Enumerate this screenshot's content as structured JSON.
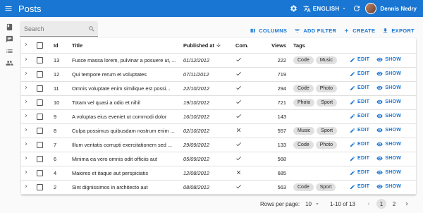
{
  "app": {
    "title": "Posts",
    "language": "ENGLISH",
    "user_name": "Dennis Nedry"
  },
  "search": {
    "placeholder": "Search"
  },
  "toolbar": {
    "columns": "COLUMNS",
    "add_filter": "ADD FILTER",
    "create": "CREATE",
    "export": "EXPORT"
  },
  "table": {
    "headers": {
      "id": "Id",
      "title": "Title",
      "published_at": "Published at",
      "com": "Com.",
      "views": "Views",
      "tags": "Tags"
    },
    "actions": {
      "edit": "EDIT",
      "show": "SHOW"
    },
    "rows": [
      {
        "id": "13",
        "title": "Fusce massa lorem, pulvinar a posuere ut, ...",
        "published_at": "01/12/2012",
        "com": true,
        "views": "222",
        "tags": [
          "Code",
          "Music"
        ]
      },
      {
        "id": "12",
        "title": "Qui tempore rerum et voluptates",
        "published_at": "07/11/2012",
        "com": true,
        "views": "719",
        "tags": []
      },
      {
        "id": "11",
        "title": "Omnis voluptate enim similique est possi...",
        "published_at": "22/10/2012",
        "com": true,
        "views": "294",
        "tags": [
          "Code",
          "Photo"
        ]
      },
      {
        "id": "10",
        "title": "Totam vel quasi a odio et nihil",
        "published_at": "19/10/2012",
        "com": true,
        "views": "721",
        "tags": [
          "Photo",
          "Sport"
        ]
      },
      {
        "id": "9",
        "title": "A voluptas eius eveniet ut commodi dolor",
        "published_at": "16/10/2012",
        "com": true,
        "views": "143",
        "tags": []
      },
      {
        "id": "8",
        "title": "Culpa possimus quibusdam nostrum enim ...",
        "published_at": "02/10/2012",
        "com": false,
        "views": "557",
        "tags": [
          "Music",
          "Sport"
        ]
      },
      {
        "id": "7",
        "title": "Illum veritatis corrupti exercitationem sed ...",
        "published_at": "29/09/2012",
        "com": true,
        "views": "133",
        "tags": [
          "Code",
          "Photo"
        ]
      },
      {
        "id": "6",
        "title": "Minima ea vero omnis odit officiis aut",
        "published_at": "05/09/2012",
        "com": true,
        "views": "568",
        "tags": []
      },
      {
        "id": "4",
        "title": "Maiores et itaque aut perspiciatis",
        "published_at": "12/08/2012",
        "com": false,
        "views": "685",
        "tags": []
      },
      {
        "id": "2",
        "title": "Sint dignissimos in architecto aut",
        "published_at": "08/08/2012",
        "com": true,
        "views": "563",
        "tags": [
          "Code",
          "Sport"
        ]
      }
    ]
  },
  "pagination": {
    "rows_per_page_label": "Rows per page:",
    "rows_per_page": "10",
    "range": "1-10 of 13",
    "pages": [
      "1",
      "2"
    ],
    "current_page": "1"
  },
  "colors": {
    "primary": "#1976d2",
    "chip": "#e0e0e0"
  },
  "icons": {
    "sidebar": [
      "book-icon",
      "chat-icon",
      "list-icon",
      "people-icon"
    ]
  }
}
